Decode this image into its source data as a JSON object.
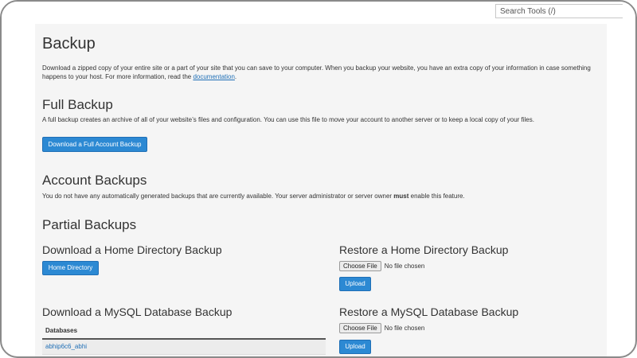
{
  "search": {
    "placeholder": "Search Tools (/)"
  },
  "page": {
    "title": "Backup",
    "intro_text": "Download a zipped copy of your entire site or a part of your site that you can save to your computer. When you backup your website, you have an extra copy of your information in case something happens to your host. For more information, read the ",
    "intro_link": "documentation",
    "intro_end": "."
  },
  "full_backup": {
    "heading": "Full Backup",
    "description": "A full backup creates an archive of all of your website’s files and configuration. You can use this file to move your account to another server or to keep a local copy of your files.",
    "button": "Download a Full Account Backup"
  },
  "account_backups": {
    "heading": "Account Backups",
    "description_pre": "You do not have any automatically generated backups that are currently available. Your server administrator or server owner ",
    "description_bold": "must",
    "description_post": " enable this feature."
  },
  "partial_backups": {
    "heading": "Partial Backups",
    "home_download_heading": "Download a Home Directory Backup",
    "home_download_button": "Home Directory",
    "home_restore_heading": "Restore a Home Directory Backup",
    "choose_file": "Choose File",
    "no_file": "No file chosen",
    "upload": "Upload",
    "mysql_download_heading": "Download a MySQL Database Backup",
    "mysql_restore_heading": "Restore a MySQL Database Backup",
    "databases_header": "Databases",
    "databases": [
      "abhip6c6_abhi"
    ]
  }
}
